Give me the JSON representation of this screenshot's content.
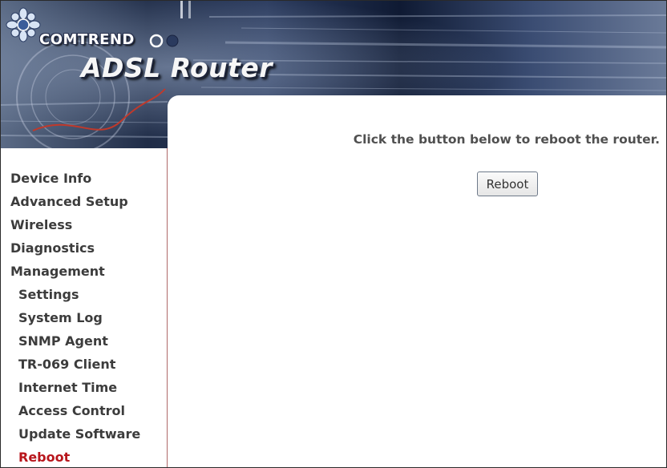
{
  "header": {
    "brand": "COMTREND",
    "product": "ADSL Router",
    "logo_icon": "comtrend-flower-logo-icon",
    "colors": {
      "banner_dark": "#1f2c47",
      "banner_light": "#6a7a98",
      "swoosh": "#c0392b"
    }
  },
  "sidebar": {
    "items": [
      {
        "label": "Device Info",
        "level": "top"
      },
      {
        "label": "Advanced Setup",
        "level": "top"
      },
      {
        "label": "Wireless",
        "level": "top"
      },
      {
        "label": "Diagnostics",
        "level": "top"
      },
      {
        "label": "Management",
        "level": "top"
      },
      {
        "label": "Settings",
        "level": "sub"
      },
      {
        "label": "System Log",
        "level": "sub"
      },
      {
        "label": "SNMP Agent",
        "level": "sub"
      },
      {
        "label": "TR-069 Client",
        "level": "sub"
      },
      {
        "label": "Internet Time",
        "level": "sub"
      },
      {
        "label": "Access Control",
        "level": "sub"
      },
      {
        "label": "Update Software",
        "level": "sub"
      },
      {
        "label": "Reboot",
        "level": "sub",
        "active": true
      }
    ],
    "active_color": "#b8161c"
  },
  "main": {
    "instruction": "Click the button below to reboot the router.",
    "reboot_button": "Reboot"
  }
}
